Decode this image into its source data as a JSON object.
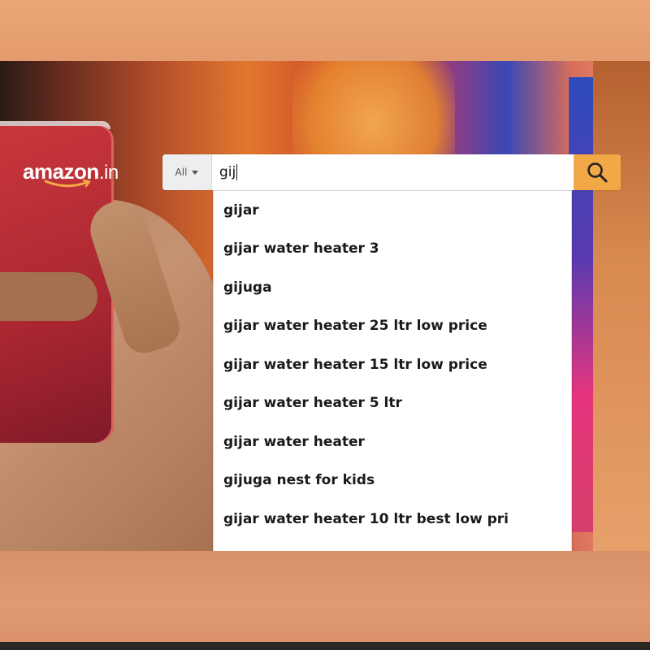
{
  "logo": {
    "text": "amazon",
    "tld": ".in"
  },
  "search": {
    "category": "All",
    "query": "gij"
  },
  "suggestions": [
    "gijar",
    "gijar water heater 3",
    "gijuga",
    "gijar water heater 25 ltr low price",
    "gijar water heater 15 ltr low price",
    "gijar water heater 5 ltr",
    "gijar water heater",
    "gijuga nest for kids",
    "gijar water heater 10 ltr best low pri"
  ],
  "colors": {
    "accent": "#f3a847",
    "frame": "#e59869"
  },
  "icons": {
    "search": "search-icon",
    "caret": "chevron-down-icon",
    "smile": "amazon-smile-icon"
  }
}
